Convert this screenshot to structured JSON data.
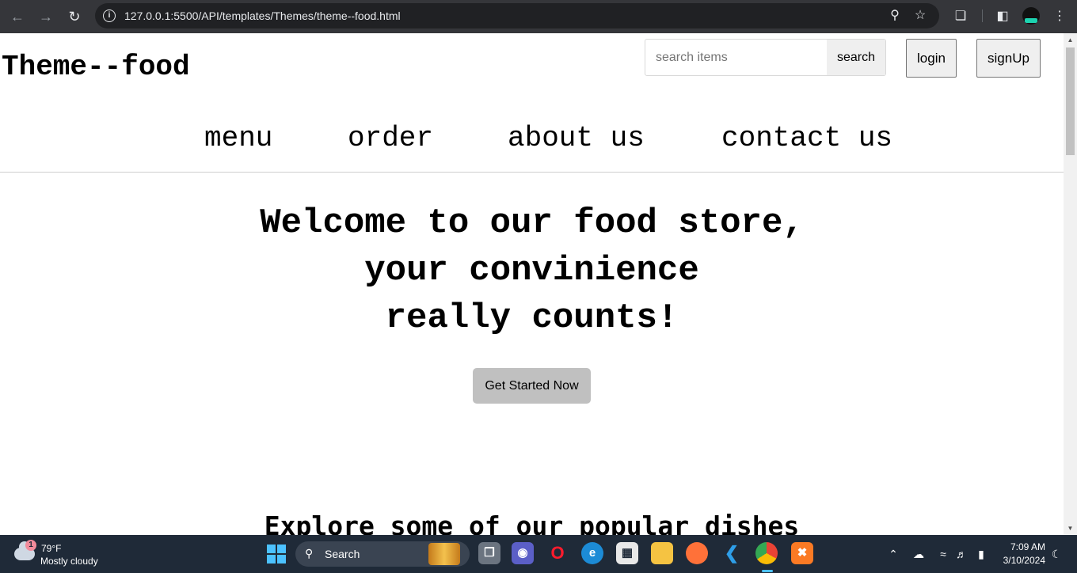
{
  "browser": {
    "url": "127.0.0.1:5500/API/templates/Themes/theme--food.html",
    "icons": {
      "back": "back-arrow-icon",
      "forward": "forward-arrow-icon",
      "reload": "reload-icon",
      "site_info": "info-icon",
      "zoom": "zoom-icon",
      "bookmark": "star-icon",
      "extensions": "puzzle-icon",
      "side_panel": "side-panel-icon",
      "menu": "kebab-menu-icon"
    }
  },
  "page": {
    "site_title": "Theme--food",
    "search": {
      "placeholder": "search items",
      "button_label": "search"
    },
    "auth": {
      "login_label": "login",
      "signup_label": "signUp"
    },
    "nav": [
      "menu",
      "order",
      "about us",
      "contact us"
    ],
    "hero": {
      "lines": [
        "Welcome to our food store,",
        "your convinience",
        "really counts!"
      ],
      "cta_label": "Get Started Now"
    },
    "section_heading": "Explore some of our popular dishes"
  },
  "taskbar": {
    "weather": {
      "badge": "1",
      "temp": "79°F",
      "desc": "Mostly cloudy"
    },
    "search_label": "Search",
    "apps": [
      "task-view",
      "meet",
      "opera",
      "edge",
      "store",
      "file-explorer",
      "firefox",
      "vscode",
      "chrome",
      "xampp"
    ],
    "clock": {
      "time": "7:09 AM",
      "date": "3/10/2024"
    }
  },
  "colors": {
    "chrome_bg": "#35363a",
    "omnibox_bg": "#202124",
    "taskbar_bg": "#1f2a38",
    "cta_bg": "#c0c0c0",
    "button_bg": "#efefef"
  }
}
